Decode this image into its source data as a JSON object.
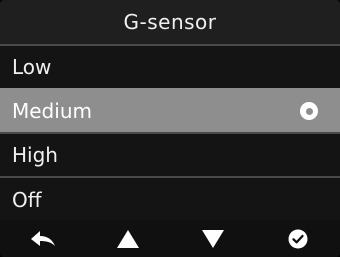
{
  "header": {
    "title": "G-sensor"
  },
  "menu": {
    "items": [
      {
        "label": "Low",
        "selected": false
      },
      {
        "label": "Medium",
        "selected": true
      },
      {
        "label": "High",
        "selected": false
      },
      {
        "label": "Off",
        "selected": false
      }
    ],
    "selected_indicator_icon": "radio-selected-icon"
  },
  "button_bar": {
    "buttons": [
      {
        "name": "back-button",
        "icon": "back-arrow-icon"
      },
      {
        "name": "up-button",
        "icon": "triangle-up-icon"
      },
      {
        "name": "down-button",
        "icon": "triangle-down-icon"
      },
      {
        "name": "confirm-button",
        "icon": "check-circle-icon"
      }
    ]
  },
  "colors": {
    "background": "#121212",
    "title_bar": "#1f1f1f",
    "selected_row": "#8e8e8e",
    "divider": "#4a4a4a",
    "text": "#f0f0f0"
  }
}
